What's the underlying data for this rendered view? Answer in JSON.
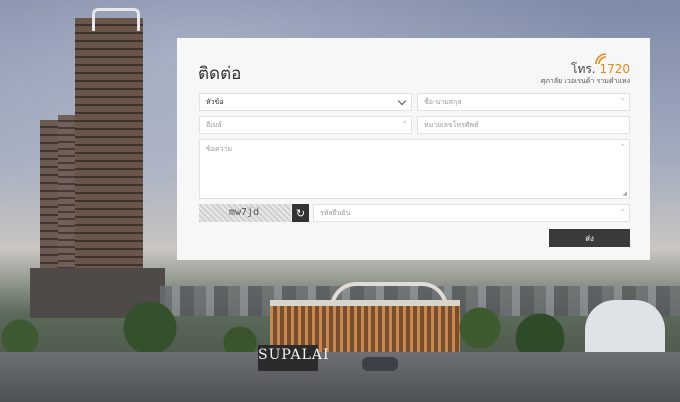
{
  "contact": {
    "title": "ติดต่อ",
    "phone_prefix": "โทร.",
    "phone_number": "1720",
    "project_name": "ศุภาลัย เวอเรนด้า รามคำแหง"
  },
  "form": {
    "subject": {
      "value": "หัวข้อ"
    },
    "name": {
      "placeholder": "ชื่อ-นามสกุล"
    },
    "email": {
      "placeholder": "อีเมล์"
    },
    "phone": {
      "placeholder": "หมายเลขโทรศัพท์"
    },
    "message": {
      "placeholder": "ข้อความ"
    },
    "captcha_text": "mw7jd",
    "captcha_code": {
      "placeholder": "รหัสยืนยัน"
    },
    "submit_label": "ส่ง"
  },
  "background": {
    "sign_text": "SUPALAI"
  },
  "colors": {
    "accent": "#e08a1a",
    "button": "#3a3a3a",
    "card_bg": "#f7f7f7"
  }
}
